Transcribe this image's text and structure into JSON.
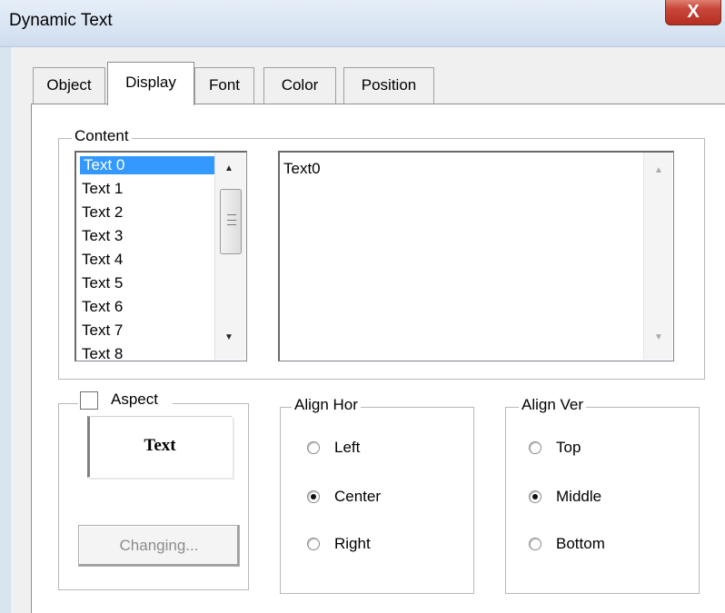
{
  "window": {
    "title": "Dynamic Text",
    "close_glyph": "X"
  },
  "tabs": [
    {
      "label": "Object"
    },
    {
      "label": "Display",
      "selected": true
    },
    {
      "label": "Font"
    },
    {
      "label": "Color"
    },
    {
      "label": "Position"
    }
  ],
  "content": {
    "label": "Content",
    "items": [
      "Text 0",
      "Text 1",
      "Text 2",
      "Text 3",
      "Text 4",
      "Text 5",
      "Text 6",
      "Text 7",
      "Text 8"
    ],
    "selected_index": 0,
    "edit_value": "Text0"
  },
  "aspect": {
    "label": "Aspect",
    "checked": false,
    "preview_text": "Text",
    "changing_button": "Changing..."
  },
  "align_hor": {
    "label": "Align Hor",
    "options": [
      "Left",
      "Center",
      "Right"
    ],
    "selected": "Center"
  },
  "align_ver": {
    "label": "Align Ver",
    "options": [
      "Top",
      "Middle",
      "Bottom"
    ],
    "selected": "Middle"
  },
  "colors": {
    "selection": "#3399ff",
    "close_button": "#c9473a"
  }
}
